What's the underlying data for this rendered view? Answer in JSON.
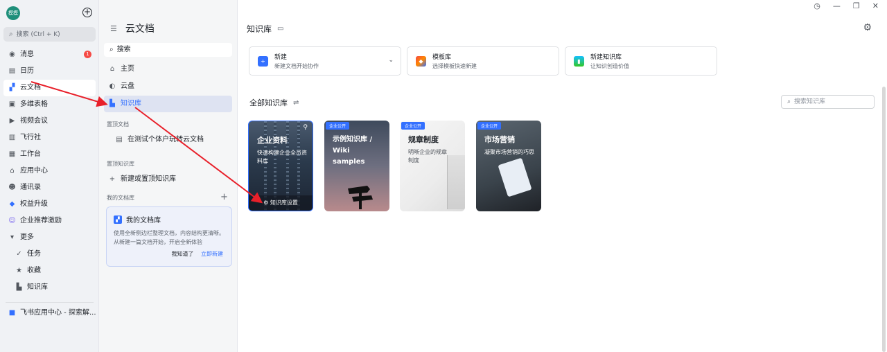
{
  "nav": {
    "avatar_text": "摸摸",
    "search_placeholder": "搜索 (Ctrl + K)",
    "items": [
      {
        "label": "消息",
        "icon": "message-icon",
        "badge": "1"
      },
      {
        "label": "日历",
        "icon": "calendar-icon"
      },
      {
        "label": "云文档",
        "icon": "docs-icon",
        "active": true
      },
      {
        "label": "多维表格",
        "icon": "base-icon"
      },
      {
        "label": "视频会议",
        "icon": "video-icon"
      },
      {
        "label": "飞行社",
        "icon": "community-icon"
      },
      {
        "label": "工作台",
        "icon": "workplace-icon"
      },
      {
        "label": "应用中心",
        "icon": "app-center-icon"
      },
      {
        "label": "通讯录",
        "icon": "contacts-icon"
      },
      {
        "label": "权益升级",
        "icon": "diamond-icon"
      },
      {
        "label": "企业推荐激励",
        "icon": "referral-icon"
      },
      {
        "label": "更多",
        "icon": "chevron-down-icon"
      },
      {
        "label": "任务",
        "icon": "task-icon"
      },
      {
        "label": "收藏",
        "icon": "star-icon"
      },
      {
        "label": "知识库",
        "icon": "wiki-icon"
      }
    ],
    "bottom_item": "飞书应用中心 - 探索解..."
  },
  "col2": {
    "title": "云文档",
    "search": "搜索",
    "home": "主页",
    "drive": "云盘",
    "wiki": "知识库",
    "section_pinned_docs": "置顶文档",
    "pinned_doc": "在测试个体户玩转云文档",
    "section_pinned_wiki": "置顶知识库",
    "new_or_pin_wiki": "新建或置顶知识库",
    "section_my_library": "我的文档库",
    "tip": {
      "title": "我的文档库",
      "body": "使用全新侧边栏整理文档，内容结构更清晰。从新建一篇文档开始，开启全新体验",
      "dismiss": "我知道了",
      "create": "立即新建"
    }
  },
  "main": {
    "title": "知识库",
    "quick": [
      {
        "title": "新建",
        "desc": "新建文档开始协作",
        "color": "#3370ff"
      },
      {
        "title": "模板库",
        "desc": "选择模板快速新建",
        "color": "#f54a45"
      },
      {
        "title": "新建知识库",
        "desc": "让知识创造价值",
        "color": "#14c0ff"
      }
    ],
    "all_title": "全部知识库",
    "kb_search_placeholder": "搜索知识库",
    "cards": [
      {
        "title": "企业资料",
        "desc": "快速构建企业全员资料库",
        "settings": "知识库设置"
      },
      {
        "tag": "企业公开",
        "title": "示例知识库 / Wiki samples",
        "desc": ""
      },
      {
        "tag": "企业公开",
        "title": "规章制度",
        "desc": "明晰企业的规章制度"
      },
      {
        "tag": "企业公开",
        "title": "市场营销",
        "desc": "凝聚市场营销的巧思"
      }
    ]
  }
}
